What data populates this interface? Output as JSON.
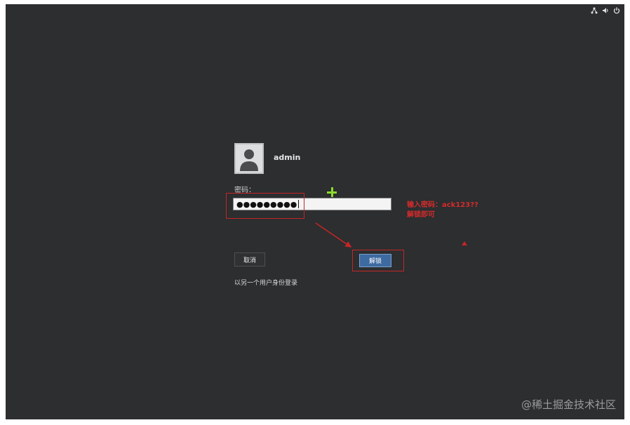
{
  "tray": {
    "icons": [
      "network-icon",
      "volume-icon",
      "power-icon"
    ]
  },
  "login": {
    "username": "admin",
    "password_label": "密码：",
    "password_value": "●●●●●●●●●",
    "cancel_label": "取消",
    "unlock_label": "解锁",
    "switch_user_link": "以另一个用户身份登录"
  },
  "annotation": {
    "line1": "输入密码：ack123??",
    "line2": "解锁即可",
    "color": "#c72525"
  },
  "watermark": "@稀土掘金技术社区",
  "colors": {
    "screen_bg": "#2c2e30",
    "unlock_button": "#3d6aa0",
    "cursor": "#8bdc2c"
  }
}
